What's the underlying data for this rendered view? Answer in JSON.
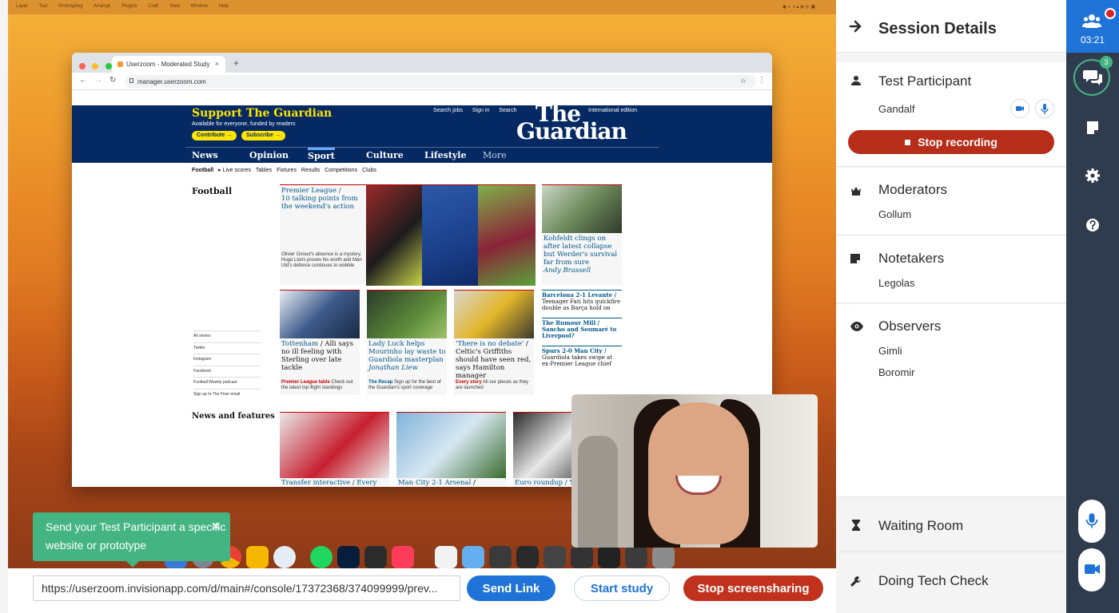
{
  "screen": {
    "menubar": [
      "Layer",
      "Text",
      "Prototyping",
      "Arrange",
      "Plugins",
      "Craft",
      "View",
      "Window",
      "Help"
    ],
    "browser": {
      "tab_title": "Userzoom - Moderated Study",
      "tab_close": "×",
      "new_tab": "+",
      "url": "manager.userzoom.com"
    },
    "guardian": {
      "support_title": "Support The Guardian",
      "support_sub": "Available for everyone, funded by readers",
      "contribute": "Contribute →",
      "subscribe": "Subscribe →",
      "links": [
        "Search jobs",
        "Sign in",
        "Search"
      ],
      "edition": "International edition",
      "logo_line1": "The",
      "logo_line2": "Guardian",
      "nav": [
        "News",
        "Opinion",
        "Sport",
        "Culture",
        "Lifestyle",
        "More"
      ],
      "subnav_active": "Football",
      "subnav": [
        "▸ Live scores",
        "Tables",
        "Fixtures",
        "Results",
        "Competitions",
        "Clubs"
      ],
      "section_football": "Football",
      "section_news": "News and features",
      "sidebar": [
        "All stories",
        "Twitter",
        "Instagram",
        "Facebook",
        "Football Weekly podcast",
        "Sign up to The Fiver email"
      ],
      "lead_kicker": "Premier League /",
      "lead_headline": "10 talking points from the weekend's action",
      "lead_standfirst": "Olivier Giroud's absence is a mystery, Hugo Lloris proves his worth and Man Utd's defence continues to wobble",
      "kohfeldt_headline": "Kohfeldt clings on after latest collapse but Werder's survival far from sure",
      "kohfeldt_byline": "Andy Brassell",
      "card1_kicker": "Tottenham",
      "card1_headline": "/ Alli says no ill feeling with Sterling over late tackle",
      "card1_small_red": "Premier League table",
      "card1_small": "Check out the latest top-flight standings",
      "card2_headline": "Lady Luck helps Mourinho lay waste to Guardiola masterplan",
      "card2_byline": "Jonathan Liew",
      "card2_small_blue": "The Recap",
      "card2_small": "Sign up for the best of the Guardian's sport coverage",
      "card3_kicker": "'There is no debate'",
      "card3_headline": "/ Celtic's Griffiths should have seen red, says Hamilton manager",
      "card3_small_red": "Every story",
      "card3_small": "All our pieces as they are launched",
      "right1_kicker": "Barcelona 2-1 Levante /",
      "right1_text": "Teenager Fati hits quickfire double as Barça hold on",
      "right2_kicker": "The Rumour Mill / Sancho and Soumaré to Liverpool?",
      "right3_kicker": "Spurs 2-0 Man City /",
      "right3_text": "Guardiola takes swipe at ex-Premier League chief",
      "nf1": "Transfer interactive / Every",
      "nf2_kicker": "Man City 2-1 Arsenal",
      "nf2": "/ Cushing",
      "nf3": "Euro roundup / Y"
    }
  },
  "tooltip": {
    "text": "Send your Test Participant a specific website or prototype",
    "close": "×"
  },
  "bottom_bar": {
    "url_value": "https://userzoom.invisionapp.com/d/main#/console/17372368/374099999/prev...",
    "send_link": "Send Link",
    "start_study": "Start study",
    "stop_screensharing": "Stop screensharing"
  },
  "session": {
    "title": "Session Details",
    "test_participant": {
      "label": "Test Participant",
      "name": "Gandalf"
    },
    "stop_recording": "Stop recording",
    "moderators": {
      "label": "Moderators",
      "names": [
        "Gollum"
      ]
    },
    "notetakers": {
      "label": "Notetakers",
      "names": [
        "Legolas"
      ]
    },
    "observers": {
      "label": "Observers",
      "names": [
        "Gimli",
        "Boromir"
      ]
    },
    "waiting_room": "Waiting Room",
    "tech_check": "Doing Tech Check"
  },
  "rail": {
    "timer": "03:21",
    "chat_badge": "3"
  },
  "colors": {
    "accent_blue": "#1f73d6",
    "record_red": "#b62d1a",
    "screenshare_red": "#c1321e",
    "tooltip_green": "#44b482",
    "rail_bg": "#2f3c4e",
    "guardian_navy": "#052962"
  }
}
